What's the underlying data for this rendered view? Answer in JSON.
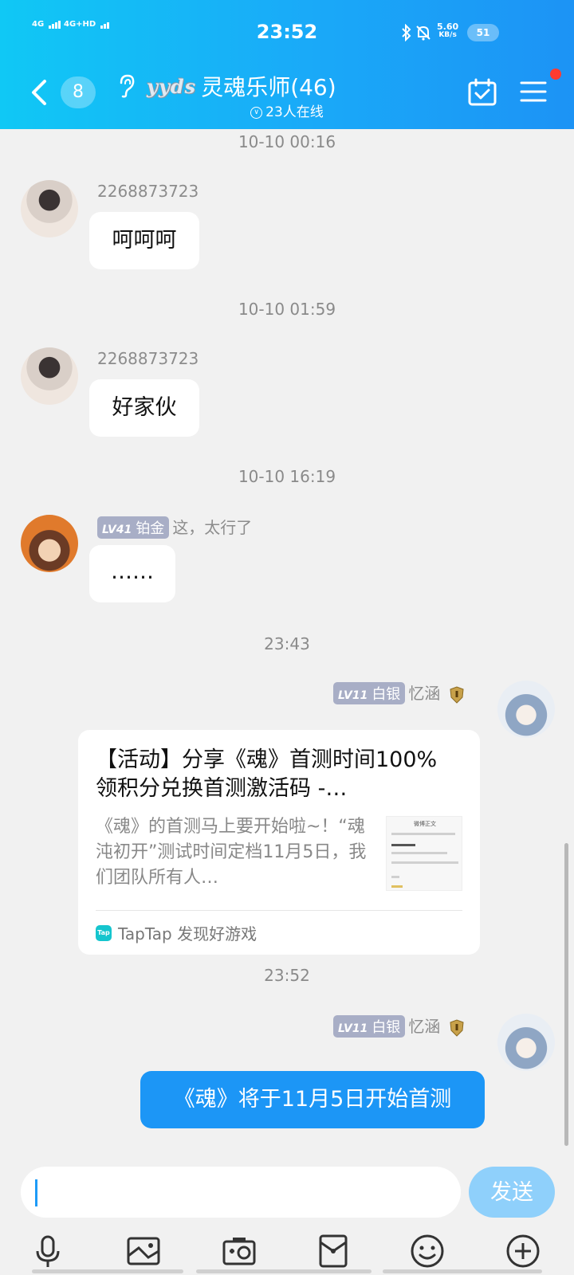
{
  "status": {
    "sim1": "4G",
    "sim2": "4G+HD",
    "time": "23:52",
    "speed_value": "5.60",
    "speed_unit": "KB/s",
    "battery": "51"
  },
  "header": {
    "unread_count": "8",
    "group_badge": "yyds",
    "group_name": "灵魂乐师(46)",
    "online_text": "23人在线",
    "notification_dot_color": "#ff3b30"
  },
  "messages": [
    {
      "time": "10-10 00:16",
      "sender": "2268873723",
      "text": "呵呵呵"
    },
    {
      "time": "10-10 01:59",
      "sender": "2268873723",
      "text": "好家伙"
    },
    {
      "time": "10-10 16:19",
      "level": "LV41",
      "rank": "铂金",
      "sender": "这，太行了",
      "text": "……"
    }
  ],
  "share": {
    "time": "23:43",
    "level": "LV11",
    "rank": "白银",
    "sender": "忆涵",
    "title": "【活动】分享《魂》首测时间100%领积分兑换首测激活码 -…",
    "desc": "《魂》的首测马上要开始啦~！“魂沌初开”测试时间定档11月5日，我们团队所有人…",
    "thumb_header": "微博正文",
    "source_logo": "Tap",
    "source": "TapTap 发现好游戏"
  },
  "mine": {
    "time": "23:52",
    "level": "LV11",
    "rank": "白银",
    "sender": "忆涵",
    "text": "《魂》将于11月5日开始首测"
  },
  "input": {
    "placeholder": "",
    "send_label": "发送"
  },
  "toolbar": [
    "microphone-icon",
    "image-icon",
    "camera-icon",
    "red-packet-icon",
    "emoji-icon",
    "plus-icon"
  ],
  "colors": {
    "header_gradient_start": "#10c8f5",
    "header_gradient_end": "#1c93f5",
    "my_bubble": "#1c96f6",
    "send_button": "#8fd0fb"
  }
}
